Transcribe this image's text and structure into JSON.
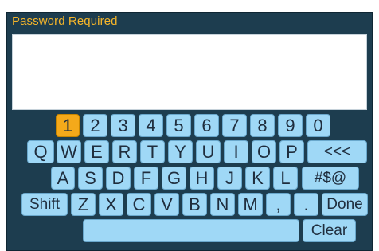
{
  "dialog": {
    "title": "Password Required",
    "password_value": ""
  },
  "keyboard": {
    "selected_key": "1",
    "row1": [
      "1",
      "2",
      "3",
      "4",
      "5",
      "6",
      "7",
      "8",
      "9",
      "0"
    ],
    "row2": [
      "Q",
      "W",
      "E",
      "R",
      "T",
      "Y",
      "U",
      "I",
      "O",
      "P",
      "<<<"
    ],
    "row3": [
      "A",
      "S",
      "D",
      "F",
      "G",
      "H",
      "J",
      "K",
      "L",
      "#$@"
    ],
    "row4": [
      "Shift",
      "Z",
      "X",
      "C",
      "V",
      "B",
      "N",
      "M",
      ",",
      ".",
      "Done"
    ],
    "row5": [
      "",
      "Clear"
    ]
  },
  "colors": {
    "dialog_bg": "#1d3d4f",
    "title": "#f5b52a",
    "key": "#9fd8f6",
    "key_selected": "#f4a91a"
  }
}
